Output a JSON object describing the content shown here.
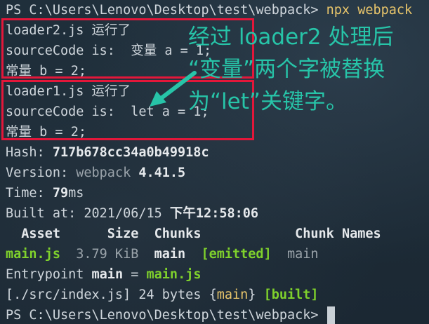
{
  "terminal": {
    "prompt_path": "PS C:\\Users\\Lenovo\\Desktop\\test\\webpack> ",
    "command": "npx webpack",
    "output": {
      "loader2_run": "loader2.js 运行了",
      "loader2_source": "sourceCode is:  变量 a = 1;",
      "loader2_const": "常量 b = 2;",
      "loader1_run": "loader1.js 运行了",
      "loader1_source": "sourceCode is:  let a = 1;",
      "loader1_const": "常量 b = 2;"
    },
    "stats": {
      "hash_label": "Hash: ",
      "hash_value": "717b678cc34a0b49918c",
      "version_label": "Version: ",
      "version_tool": "webpack ",
      "version_number": "4.41.5",
      "time_label": "Time: ",
      "time_value": "79",
      "time_unit": "ms",
      "built_label": "Built at: ",
      "built_date": "2021/06/15 ",
      "built_time": "下午12:58:06"
    },
    "asset_table": {
      "headers": [
        "  Asset",
        "      Size",
        "  Chunks",
        "            Chunk Names"
      ],
      "row": {
        "asset": "main.js",
        "size": "  3.79 KiB",
        "chunk": "  main",
        "flag": "  [emitted]",
        "chunk_name": "  main"
      }
    },
    "entrypoint": {
      "label": "Entrypoint ",
      "name": "main",
      "eq": " = ",
      "file": "main.js"
    },
    "module_line": {
      "path": "[./src/index.js]",
      "size": " 24 bytes ",
      "chunk_open": "{",
      "chunk": "main",
      "chunk_close": "}",
      "built": " [built]"
    },
    "final_prompt": "PS C:\\Users\\Lenovo\\Desktop\\test\\webpack>"
  },
  "annotation": {
    "line1": "经过 loader2 处理后",
    "line2": "“变量”两个字被替换",
    "line3": "为“let”关键字。",
    "color": "#27c4a8"
  },
  "highlight_color": "#e3173a"
}
